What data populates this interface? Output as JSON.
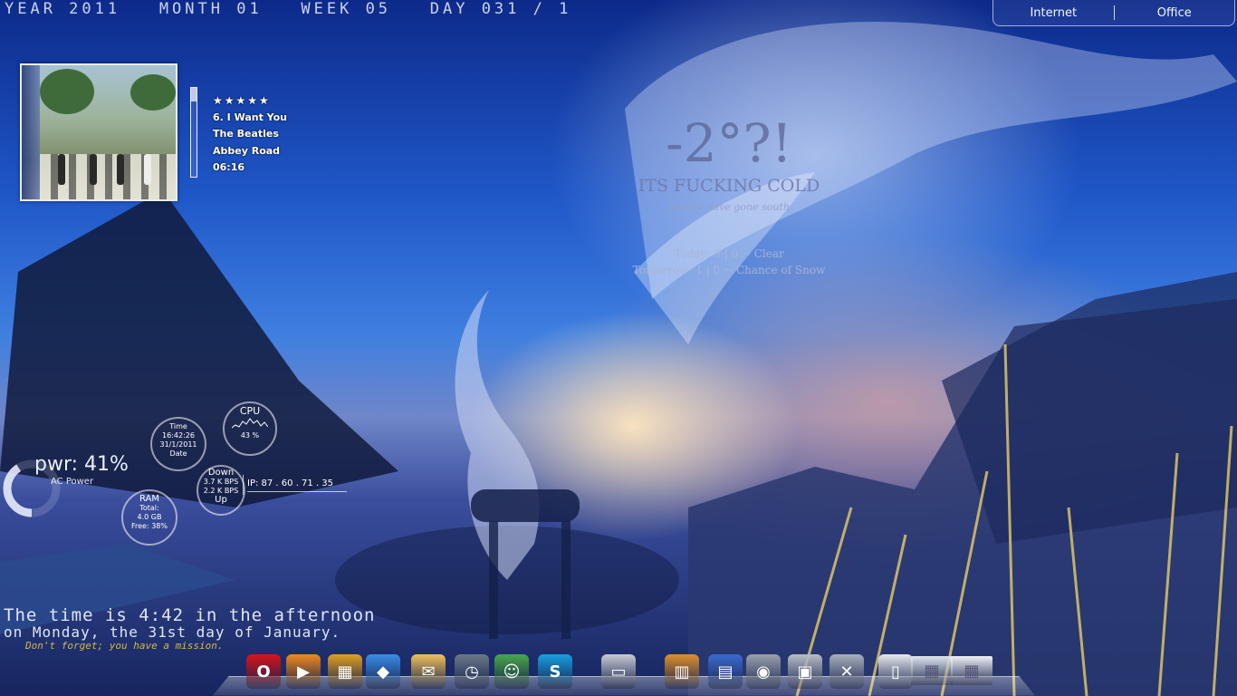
{
  "dateline": "YEAR 2011   MONTH 01   WEEK 05   DAY 031 / 1",
  "toplinks": {
    "internet": "Internet",
    "office": "Office"
  },
  "music": {
    "stars": "★★★★★",
    "rating": 5,
    "track": "6. I Want You",
    "artist": "The Beatles",
    "album": "Abbey Road",
    "time": "06:16",
    "progress": 0.15
  },
  "weather": {
    "temp": "-2°?!",
    "headline": "ITS FUCKING COLD",
    "sub": "Should have gone south",
    "today": "Today:  0  |  0 ~ Clear",
    "tomorrow": "Tomorrow:  1  |  0 ~ Chance of Snow"
  },
  "system": {
    "time_label": "Time",
    "time_value": "16:42:26",
    "date_value": "31/1/2011",
    "date_label": "Date",
    "cpu_label": "CPU",
    "cpu_value": "43 %",
    "down_label": "Down",
    "down_value": "3.7 K BPS",
    "up_value": "2.2 K BPS",
    "up_label": "Up",
    "ip": "IP: 87 . 60 . 71 . 35",
    "ram_label": "RAM",
    "ram_total": "Total:",
    "ram_total_value": "4.0 GB",
    "ram_free": "Free: 38%",
    "pwr": "pwr: 41%",
    "pwr_fraction": 0.41,
    "pwr_source": "AC Power"
  },
  "clock_text": {
    "line1": "The time is 4:42 in the afternoon",
    "line2": "on Monday, the 31st day of January.",
    "line3": "Don't forget; you have a mission."
  },
  "dock": [
    {
      "name": "opera-icon",
      "glyph": "O",
      "color": "#d8141a"
    },
    {
      "name": "media-player-icon",
      "glyph": "▶",
      "color": "#f08a1c"
    },
    {
      "name": "office-icon",
      "glyph": "▦",
      "color": "#e0a020"
    },
    {
      "name": "dropbox-icon",
      "glyph": "◆",
      "color": "#3a8ee6"
    },
    {
      "name": "mail-icon",
      "glyph": "✉",
      "color": "#f0c25a"
    },
    {
      "name": "clock-icon",
      "glyph": "◷",
      "color": "#6c7a88"
    },
    {
      "name": "messenger-icon",
      "glyph": "☺",
      "color": "#4aa84a"
    },
    {
      "name": "skype-icon",
      "glyph": "S",
      "color": "#19a0e0"
    },
    {
      "name": "folder-icon",
      "glyph": "▭",
      "color": "#c8ccd2"
    },
    {
      "name": "recycle-bin-icon",
      "glyph": "▥",
      "color": "#e0902a"
    },
    {
      "name": "network-icon",
      "glyph": "▤",
      "color": "#3a6ad0"
    },
    {
      "name": "volume-icon",
      "glyph": "◉",
      "color": "#9aa2ac"
    },
    {
      "name": "calculator-icon",
      "glyph": "▣",
      "color": "#b8bec6"
    },
    {
      "name": "tools-icon",
      "glyph": "✕",
      "color": "#a8b0ba"
    },
    {
      "name": "notepad-icon",
      "glyph": "▯",
      "color": "#e6eaf0"
    },
    {
      "name": "window-thumbnail-icon",
      "glyph": "▦",
      "color": "#dfe6ee"
    },
    {
      "name": "window-thumbnail-2-icon",
      "glyph": "▦",
      "color": "#f0f2f6"
    }
  ]
}
